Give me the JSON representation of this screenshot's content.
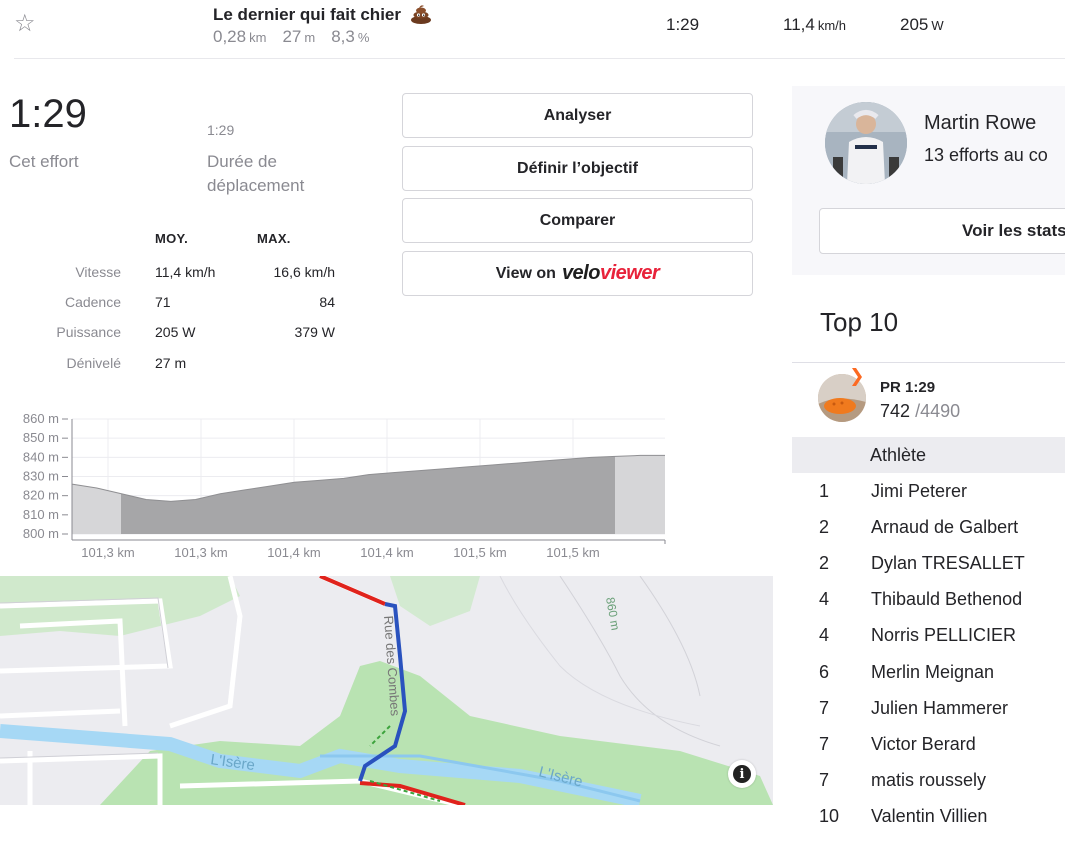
{
  "segment": {
    "name": "Le dernier qui fait chier",
    "emoji_icon": "pile-of-poo-icon",
    "distance": "0,28",
    "distance_unit": "km",
    "elevation": "27",
    "elevation_unit": "m",
    "grade": "8,3",
    "grade_unit": "%",
    "time": "1:29",
    "speed": "11,4",
    "speed_unit": "km/h",
    "power": "205",
    "power_unit": "W"
  },
  "effort": {
    "elapsed_time": "1:29",
    "elapsed_label": "Cet effort",
    "moving_time": "1:29",
    "moving_label_1": "Durée de",
    "moving_label_2": "déplacement"
  },
  "stats": {
    "col_avg": "MOY.",
    "col_max": "MAX.",
    "rows": [
      {
        "label": "Vitesse",
        "avg": "11,4 km/h",
        "max": "16,6 km/h"
      },
      {
        "label": "Cadence",
        "avg": "71",
        "max": "84"
      },
      {
        "label": "Puissance",
        "avg": "205 W",
        "max": "379 W"
      },
      {
        "label": "Dénivelé",
        "avg": "27 m",
        "max": ""
      }
    ]
  },
  "buttons": {
    "analyze": "Analyser",
    "set_goal": "Définir l’objectif",
    "compare": "Comparer",
    "view_on": "View on",
    "veloviewer_a": "velo",
    "veloviewer_b": "viewer"
  },
  "chart_data": {
    "type": "area",
    "y_ticks": [
      "860 m",
      "850 m",
      "840 m",
      "830 m",
      "820 m",
      "810 m",
      "800 m"
    ],
    "x_ticks": [
      "101,3 km",
      "101,3 km",
      "101,4 km",
      "101,4 km",
      "101,5 km",
      "101,5 km"
    ],
    "ylim": [
      800,
      860
    ],
    "profile_m": [
      826,
      824,
      821,
      818,
      817,
      818,
      821,
      823,
      825,
      827,
      828,
      829,
      831,
      832,
      833,
      834,
      835,
      836,
      837,
      838,
      839,
      840,
      840.5,
      841,
      841
    ],
    "colors": {
      "segment_fill": "#a6a6a8",
      "context_fill": "#d6d6d8"
    }
  },
  "map": {
    "labels": [
      "Rue des Combes",
      "L'Isère",
      "L'Isère",
      "860 m"
    ],
    "info_icon": "info-icon"
  },
  "leader": {
    "name": "Martin Rowe",
    "efforts": "13 efforts au co",
    "stats_button": "Voir les stats"
  },
  "top10": {
    "title": "Top 10",
    "pr_label": "PR",
    "pr_time": "1:29",
    "pr_rank": "742",
    "pr_total": "/4490",
    "header": "Athlète",
    "entries": [
      {
        "rank": "1",
        "name": "Jimi Peterer"
      },
      {
        "rank": "2",
        "name": "Arnaud de Galbert"
      },
      {
        "rank": "2",
        "name": "Dylan TRESALLET"
      },
      {
        "rank": "4",
        "name": "Thibauld Bethenod"
      },
      {
        "rank": "4",
        "name": "Norris PELLICIER"
      },
      {
        "rank": "6",
        "name": "Merlin Meignan"
      },
      {
        "rank": "7",
        "name": "Julien Hammerer"
      },
      {
        "rank": "7",
        "name": "Victor Berard"
      },
      {
        "rank": "7",
        "name": "matis roussely"
      },
      {
        "rank": "10",
        "name": "Valentin Villien"
      }
    ]
  },
  "colors": {
    "accent": "#fc4c02",
    "route_red": "#e0231c",
    "route_blue": "#2a52be",
    "water": "#a6d8f5",
    "park": "#b8e2b0"
  }
}
